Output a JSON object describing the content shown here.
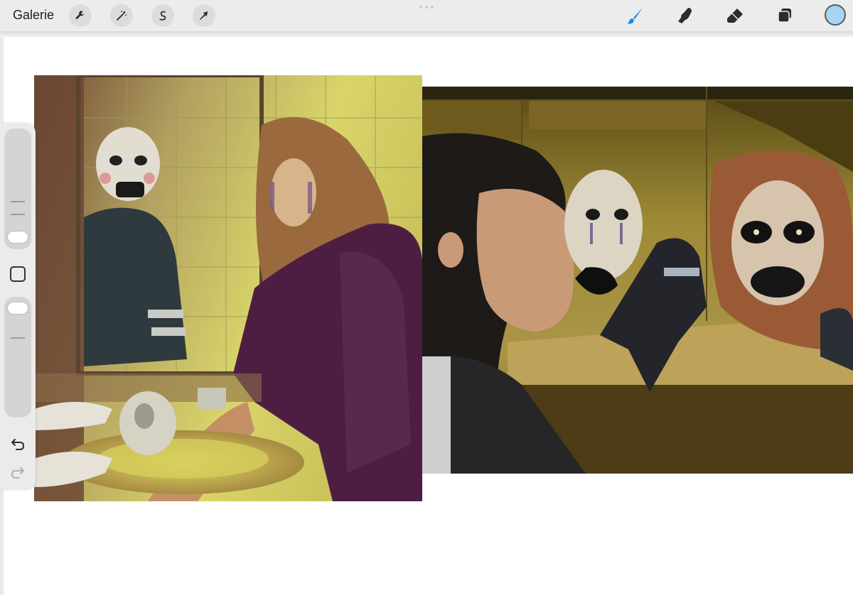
{
  "toolbar": {
    "gallery_label": "Galerie",
    "left_tools": [
      "wrench-icon",
      "magic-wand-icon",
      "selection-icon",
      "transform-arrow-icon"
    ],
    "right_tools": [
      "brush-icon",
      "smudge-icon",
      "eraser-icon",
      "layers-icon"
    ],
    "active_color": "#a6d4f5",
    "active_tool_color": "#1f88e5"
  },
  "sidebar": {
    "brush_size_level": 0.3,
    "opacity_level": 0.7,
    "undo_icon": "undo-icon",
    "redo_icon": "redo-icon"
  },
  "canvas": {
    "artworks": [
      "bathroom-mirror-painting",
      "mirror-faces-painting"
    ]
  }
}
